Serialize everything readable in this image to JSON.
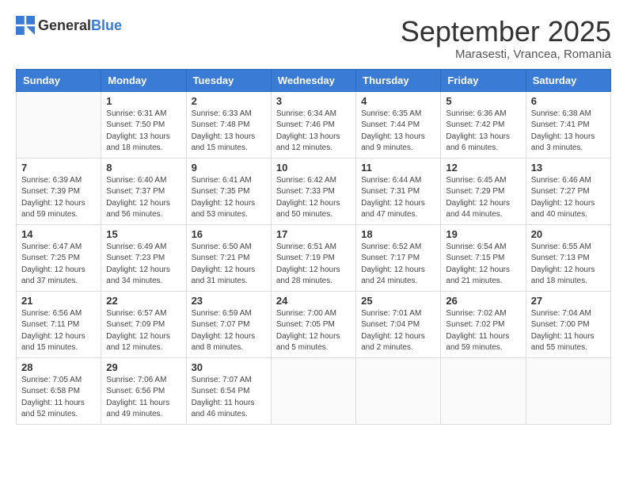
{
  "header": {
    "logo_general": "General",
    "logo_blue": "Blue",
    "month_title": "September 2025",
    "location": "Marasesti, Vrancea, Romania"
  },
  "days_of_week": [
    "Sunday",
    "Monday",
    "Tuesday",
    "Wednesday",
    "Thursday",
    "Friday",
    "Saturday"
  ],
  "weeks": [
    [
      {
        "day": "",
        "info": ""
      },
      {
        "day": "1",
        "info": "Sunrise: 6:31 AM\nSunset: 7:50 PM\nDaylight: 13 hours\nand 18 minutes."
      },
      {
        "day": "2",
        "info": "Sunrise: 6:33 AM\nSunset: 7:48 PM\nDaylight: 13 hours\nand 15 minutes."
      },
      {
        "day": "3",
        "info": "Sunrise: 6:34 AM\nSunset: 7:46 PM\nDaylight: 13 hours\nand 12 minutes."
      },
      {
        "day": "4",
        "info": "Sunrise: 6:35 AM\nSunset: 7:44 PM\nDaylight: 13 hours\nand 9 minutes."
      },
      {
        "day": "5",
        "info": "Sunrise: 6:36 AM\nSunset: 7:42 PM\nDaylight: 13 hours\nand 6 minutes."
      },
      {
        "day": "6",
        "info": "Sunrise: 6:38 AM\nSunset: 7:41 PM\nDaylight: 13 hours\nand 3 minutes."
      }
    ],
    [
      {
        "day": "7",
        "info": "Sunrise: 6:39 AM\nSunset: 7:39 PM\nDaylight: 12 hours\nand 59 minutes."
      },
      {
        "day": "8",
        "info": "Sunrise: 6:40 AM\nSunset: 7:37 PM\nDaylight: 12 hours\nand 56 minutes."
      },
      {
        "day": "9",
        "info": "Sunrise: 6:41 AM\nSunset: 7:35 PM\nDaylight: 12 hours\nand 53 minutes."
      },
      {
        "day": "10",
        "info": "Sunrise: 6:42 AM\nSunset: 7:33 PM\nDaylight: 12 hours\nand 50 minutes."
      },
      {
        "day": "11",
        "info": "Sunrise: 6:44 AM\nSunset: 7:31 PM\nDaylight: 12 hours\nand 47 minutes."
      },
      {
        "day": "12",
        "info": "Sunrise: 6:45 AM\nSunset: 7:29 PM\nDaylight: 12 hours\nand 44 minutes."
      },
      {
        "day": "13",
        "info": "Sunrise: 6:46 AM\nSunset: 7:27 PM\nDaylight: 12 hours\nand 40 minutes."
      }
    ],
    [
      {
        "day": "14",
        "info": "Sunrise: 6:47 AM\nSunset: 7:25 PM\nDaylight: 12 hours\nand 37 minutes."
      },
      {
        "day": "15",
        "info": "Sunrise: 6:49 AM\nSunset: 7:23 PM\nDaylight: 12 hours\nand 34 minutes."
      },
      {
        "day": "16",
        "info": "Sunrise: 6:50 AM\nSunset: 7:21 PM\nDaylight: 12 hours\nand 31 minutes."
      },
      {
        "day": "17",
        "info": "Sunrise: 6:51 AM\nSunset: 7:19 PM\nDaylight: 12 hours\nand 28 minutes."
      },
      {
        "day": "18",
        "info": "Sunrise: 6:52 AM\nSunset: 7:17 PM\nDaylight: 12 hours\nand 24 minutes."
      },
      {
        "day": "19",
        "info": "Sunrise: 6:54 AM\nSunset: 7:15 PM\nDaylight: 12 hours\nand 21 minutes."
      },
      {
        "day": "20",
        "info": "Sunrise: 6:55 AM\nSunset: 7:13 PM\nDaylight: 12 hours\nand 18 minutes."
      }
    ],
    [
      {
        "day": "21",
        "info": "Sunrise: 6:56 AM\nSunset: 7:11 PM\nDaylight: 12 hours\nand 15 minutes."
      },
      {
        "day": "22",
        "info": "Sunrise: 6:57 AM\nSunset: 7:09 PM\nDaylight: 12 hours\nand 12 minutes."
      },
      {
        "day": "23",
        "info": "Sunrise: 6:59 AM\nSunset: 7:07 PM\nDaylight: 12 hours\nand 8 minutes."
      },
      {
        "day": "24",
        "info": "Sunrise: 7:00 AM\nSunset: 7:05 PM\nDaylight: 12 hours\nand 5 minutes."
      },
      {
        "day": "25",
        "info": "Sunrise: 7:01 AM\nSunset: 7:04 PM\nDaylight: 12 hours\nand 2 minutes."
      },
      {
        "day": "26",
        "info": "Sunrise: 7:02 AM\nSunset: 7:02 PM\nDaylight: 11 hours\nand 59 minutes."
      },
      {
        "day": "27",
        "info": "Sunrise: 7:04 AM\nSunset: 7:00 PM\nDaylight: 11 hours\nand 55 minutes."
      }
    ],
    [
      {
        "day": "28",
        "info": "Sunrise: 7:05 AM\nSunset: 6:58 PM\nDaylight: 11 hours\nand 52 minutes."
      },
      {
        "day": "29",
        "info": "Sunrise: 7:06 AM\nSunset: 6:56 PM\nDaylight: 11 hours\nand 49 minutes."
      },
      {
        "day": "30",
        "info": "Sunrise: 7:07 AM\nSunset: 6:54 PM\nDaylight: 11 hours\nand 46 minutes."
      },
      {
        "day": "",
        "info": ""
      },
      {
        "day": "",
        "info": ""
      },
      {
        "day": "",
        "info": ""
      },
      {
        "day": "",
        "info": ""
      }
    ]
  ]
}
